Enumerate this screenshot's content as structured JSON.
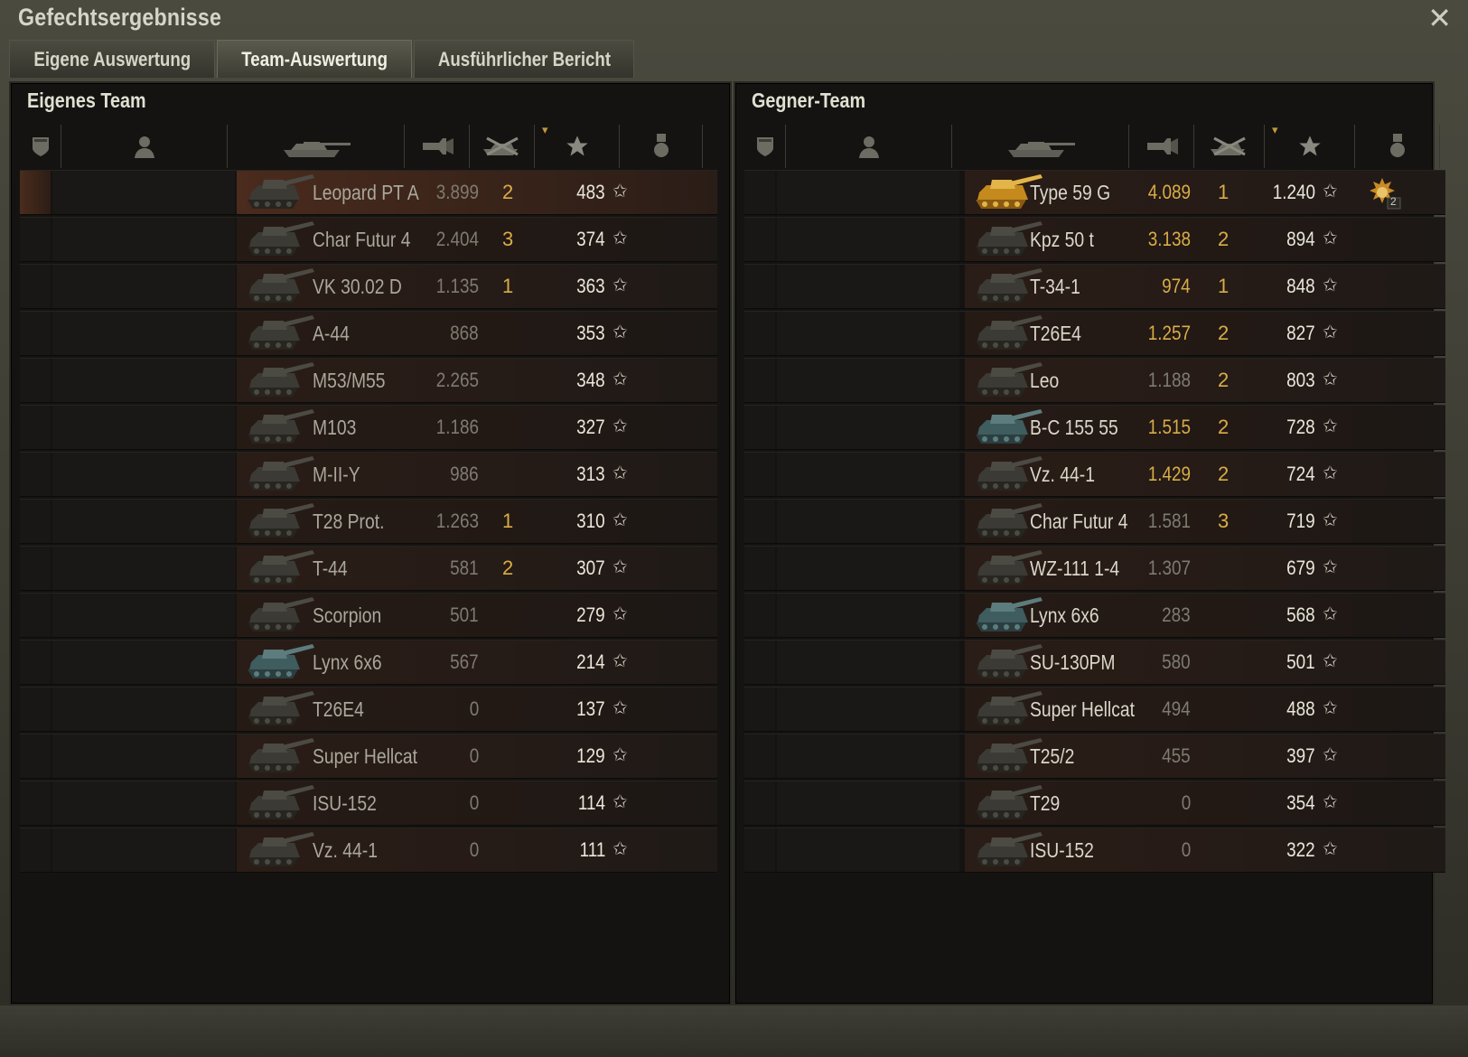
{
  "window": {
    "title": "Gefechtsergebnisse",
    "close_icon": "close-icon"
  },
  "tabs": [
    {
      "label": "Eigene Auswertung",
      "active": false
    },
    {
      "label": "Team-Auswertung",
      "active": true
    },
    {
      "label": "Ausführlicher Bericht",
      "active": false
    }
  ],
  "own_team": {
    "title": "Eigenes Team",
    "columns": [
      "squad-icon",
      "player-icon",
      "tank-icon",
      "damage-icon",
      "kills-icon",
      "xp-star-icon",
      "medal-icon"
    ],
    "rows": [
      {
        "tank": "Leopard PT A",
        "damage": "3.899",
        "kills": "2",
        "xp": "483",
        "highlight": true
      },
      {
        "tank": "Char Futur 4",
        "damage": "2.404",
        "kills": "3",
        "xp": "374"
      },
      {
        "tank": "VK 30.02 D",
        "damage": "1.135",
        "kills": "1",
        "xp": "363"
      },
      {
        "tank": "A-44",
        "damage": "868",
        "kills": "",
        "xp": "353"
      },
      {
        "tank": "M53/M55",
        "damage": "2.265",
        "kills": "",
        "xp": "348"
      },
      {
        "tank": "M103",
        "damage": "1.186",
        "kills": "",
        "xp": "327"
      },
      {
        "tank": "M-II-Y",
        "damage": "986",
        "kills": "",
        "xp": "313"
      },
      {
        "tank": "T28 Prot.",
        "damage": "1.263",
        "kills": "1",
        "xp": "310"
      },
      {
        "tank": "T-44",
        "damage": "581",
        "kills": "2",
        "xp": "307"
      },
      {
        "tank": "Scorpion",
        "damage": "501",
        "kills": "",
        "xp": "279"
      },
      {
        "tank": "Lynx 6x6",
        "damage": "567",
        "kills": "",
        "xp": "214"
      },
      {
        "tank": "T26E4",
        "damage": "0",
        "kills": "",
        "xp": "137"
      },
      {
        "tank": "Super Hellcat",
        "damage": "0",
        "kills": "",
        "xp": "129"
      },
      {
        "tank": "ISU-152",
        "damage": "0",
        "kills": "",
        "xp": "114"
      },
      {
        "tank": "Vz. 44-1",
        "damage": "0",
        "kills": "",
        "xp": "111"
      }
    ]
  },
  "enemy_team": {
    "title": "Gegner-Team",
    "columns": [
      "squad-icon",
      "player-icon",
      "tank-icon",
      "damage-icon",
      "kills-icon",
      "xp-star-icon",
      "medal-icon"
    ],
    "rows": [
      {
        "tank": "Type 59 G",
        "damage": "4.089",
        "kills": "1",
        "xp": "1.240",
        "medal": "2",
        "gold": true,
        "dmg_color": "#d9ad46"
      },
      {
        "tank": "Kpz 50 t",
        "damage": "3.138",
        "kills": "2",
        "xp": "894",
        "dmg_color": "#d9ad46"
      },
      {
        "tank": "T-34-1",
        "damage": "974",
        "kills": "1",
        "xp": "848",
        "dmg_color": "#d9ad46"
      },
      {
        "tank": "T26E4",
        "damage": "1.257",
        "kills": "2",
        "xp": "827",
        "dmg_color": "#d9ad46"
      },
      {
        "tank": "Leo",
        "damage": "1.188",
        "kills": "2",
        "xp": "803"
      },
      {
        "tank": "B-C 155 55",
        "damage": "1.515",
        "kills": "2",
        "xp": "728",
        "dmg_color": "#d9ad46"
      },
      {
        "tank": "Vz. 44-1",
        "damage": "1.429",
        "kills": "2",
        "xp": "724",
        "dmg_color": "#d9ad46"
      },
      {
        "tank": "Char Futur 4",
        "damage": "1.581",
        "kills": "3",
        "xp": "719"
      },
      {
        "tank": "WZ-111 1-4",
        "damage": "1.307",
        "kills": "",
        "xp": "679"
      },
      {
        "tank": "Lynx 6x6",
        "damage": "283",
        "kills": "",
        "xp": "568"
      },
      {
        "tank": "SU-130PM",
        "damage": "580",
        "kills": "",
        "xp": "501"
      },
      {
        "tank": "Super Hellcat",
        "damage": "494",
        "kills": "",
        "xp": "488"
      },
      {
        "tank": "T25/2",
        "damage": "455",
        "kills": "",
        "xp": "397"
      },
      {
        "tank": "T29",
        "damage": "0",
        "kills": "",
        "xp": "354"
      },
      {
        "tank": "ISU-152",
        "damage": "0",
        "kills": "",
        "xp": "322"
      }
    ]
  },
  "colors": {
    "gold": "#d9ad46",
    "text": "#b8b6a8",
    "dim_damage": "#7e7b70",
    "xp": "#e9e7da"
  }
}
